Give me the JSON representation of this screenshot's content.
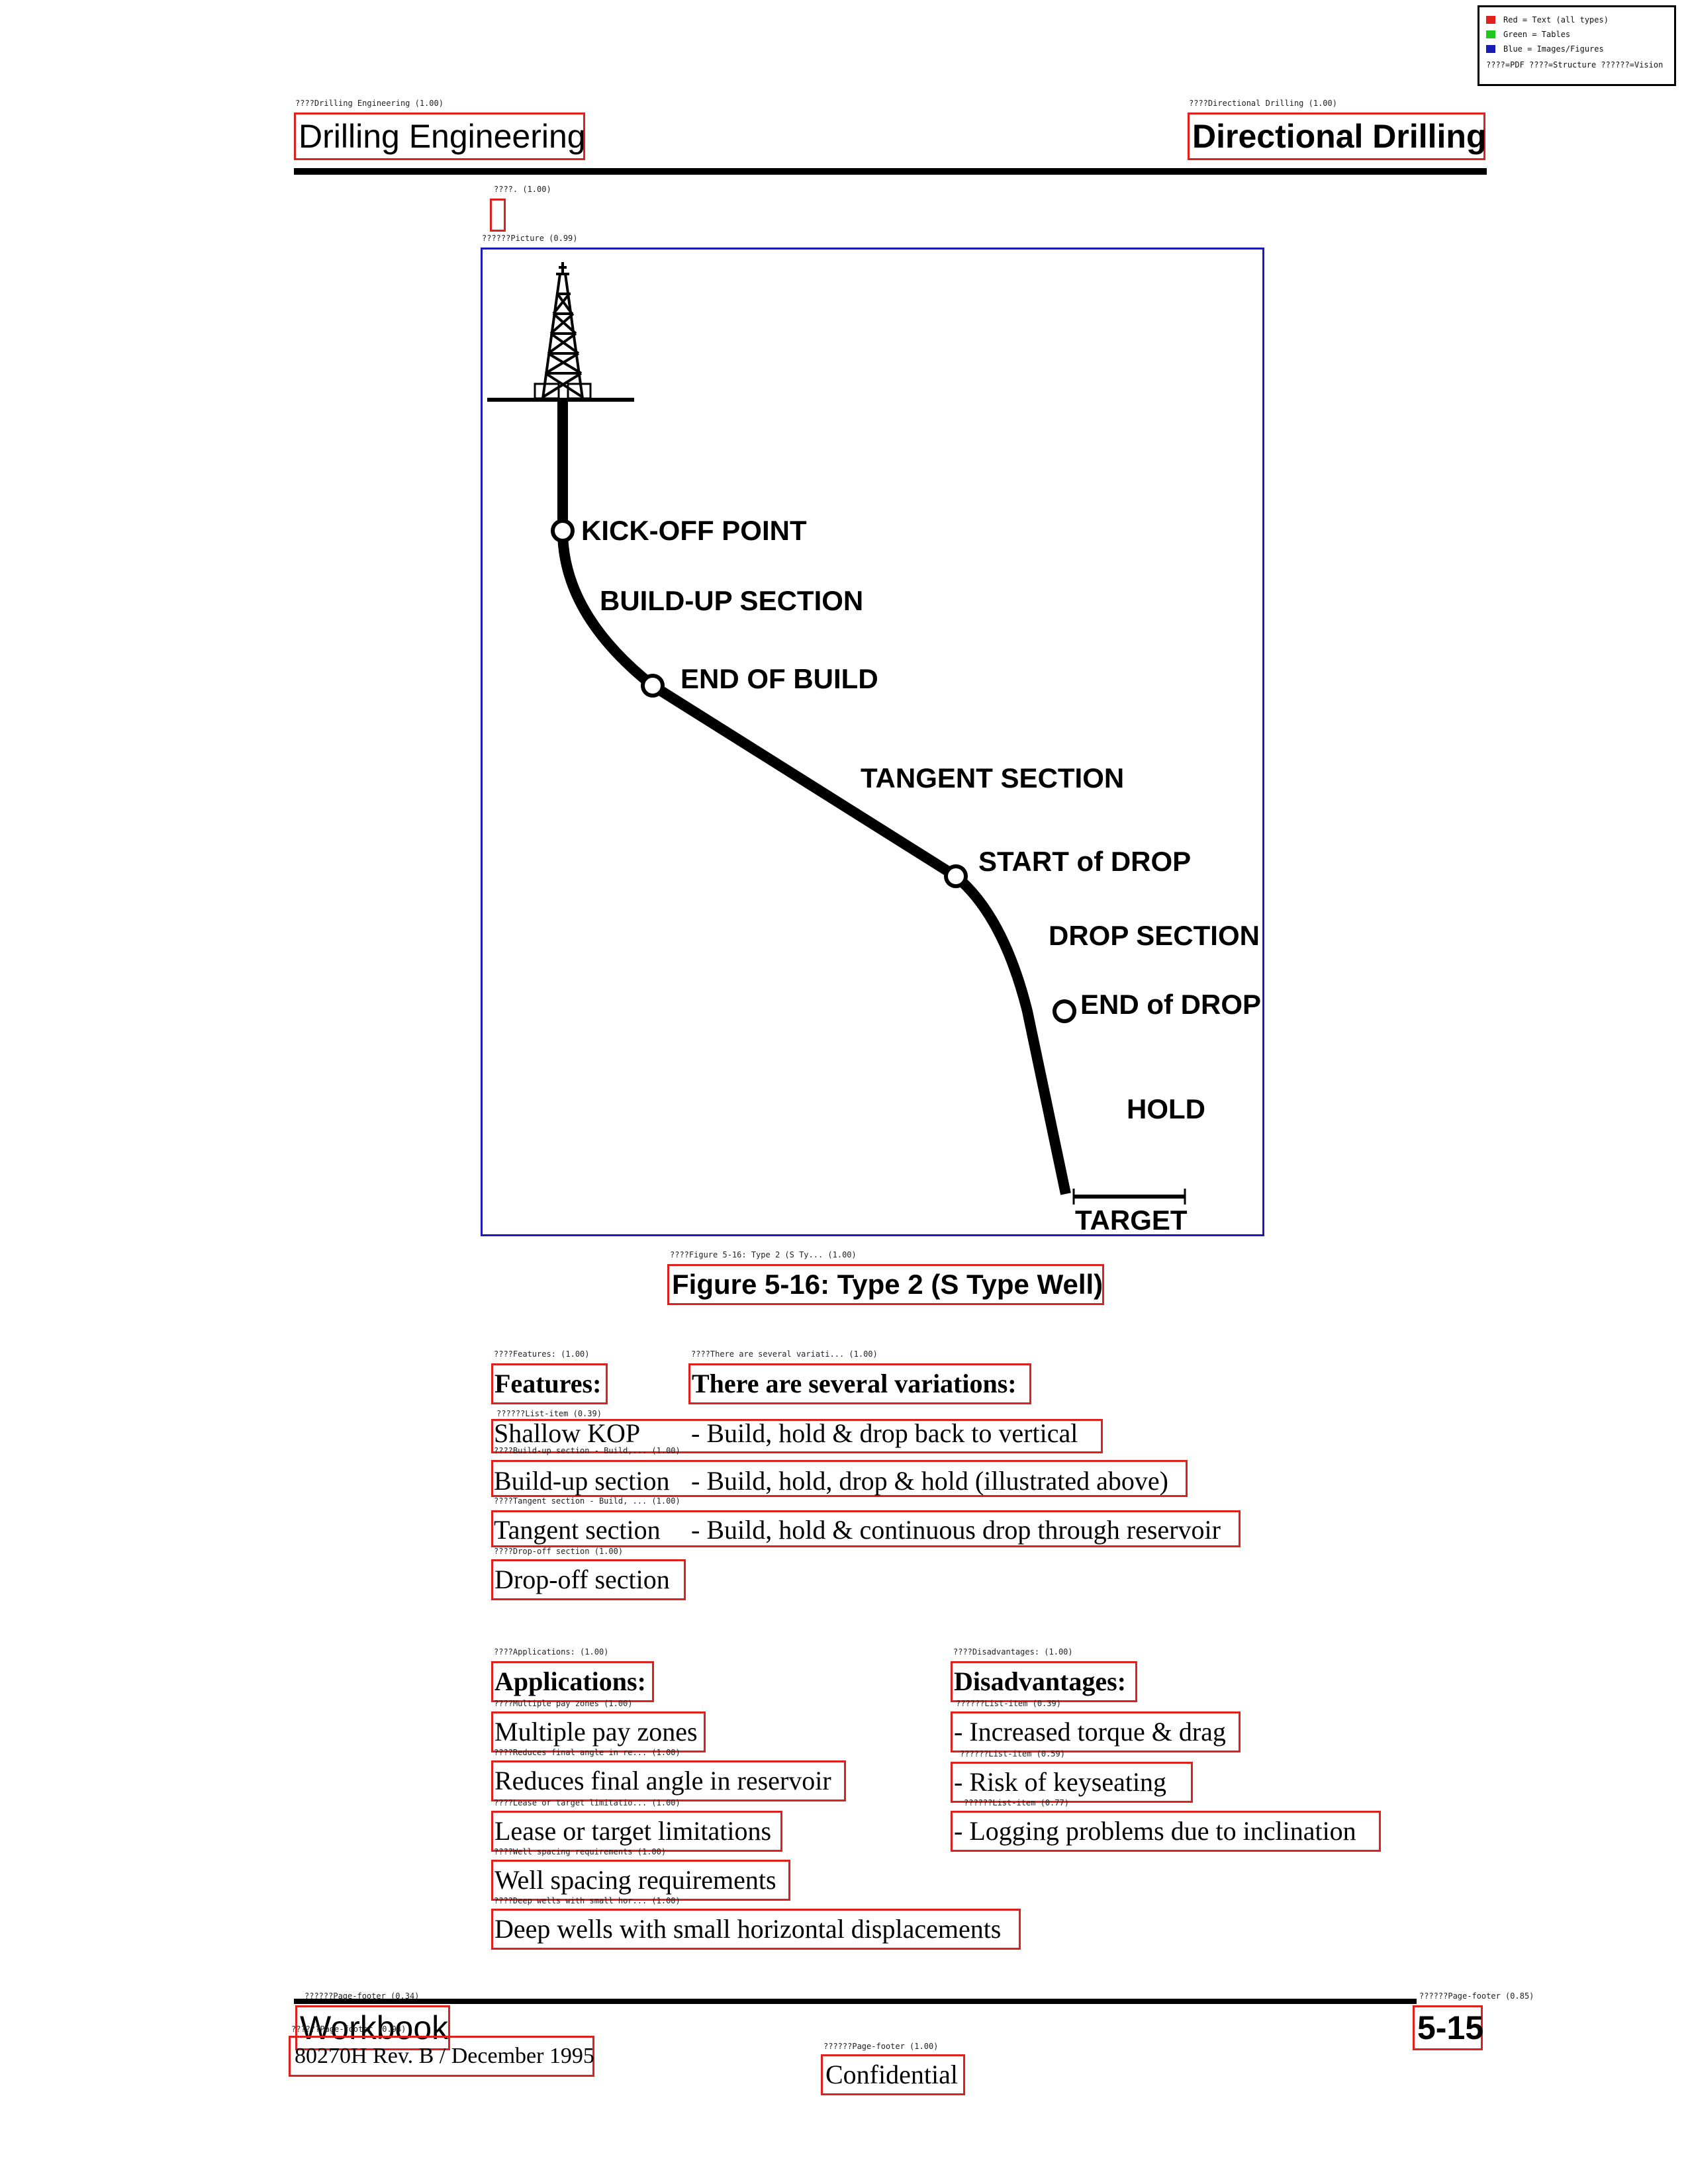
{
  "legend": {
    "items": [
      {
        "color": "#e0201c",
        "label": "Red = Text (all types)"
      },
      {
        "color": "#1ec81e",
        "label": "Green = Tables"
      },
      {
        "color": "#1a1ab4",
        "label": "Blue = Images/Figures"
      }
    ],
    "note": "????=PDF ????=Structure ??????=Vision"
  },
  "header": {
    "left_tag": "????Drilling Engineering (1.00)",
    "left_title": "Drilling Engineering",
    "right_tag": "????Directional Drilling (1.00)",
    "right_title": "Directional Drilling"
  },
  "small_mark_tag": "????. (1.00)",
  "figure": {
    "tag": "??????Picture (0.99)",
    "labels": {
      "kickoff": "KICK-OFF POINT",
      "buildup": "BUILD-UP SECTION",
      "endbuild": "END OF BUILD",
      "tangent": "TANGENT SECTION",
      "startdrop": "START of DROP",
      "dropsection": "DROP SECTION",
      "enddrop": "END of DROP",
      "hold": "HOLD",
      "target": "TARGET"
    },
    "caption_tag": "????Figure 5-16: Type 2 (S Ty... (1.00)",
    "caption": "Figure 5-16: Type 2 (S Type Well)"
  },
  "features": {
    "tag": "????Features: (1.00)",
    "heading": "Features:",
    "variations_tag": "????There are several variati... (1.00)",
    "variations_heading": "There are several variations:",
    "rows": [
      {
        "tag": "??????List-item (0.39)",
        "label": "Shallow KOP",
        "text": "- Build, hold & drop back to vertical"
      },
      {
        "tag": "????Build-up section - Build,... (1.00)",
        "label": "Build-up section",
        "text": "- Build, hold, drop & hold (illustrated above)"
      },
      {
        "tag": "????Tangent section - Build, ... (1.00)",
        "label": "Tangent section",
        "text": "- Build, hold & continuous drop through reservoir"
      },
      {
        "tag": "????Drop-off section (1.00)",
        "label": "Drop-off section",
        "text": ""
      }
    ]
  },
  "applications": {
    "tag": "????Applications: (1.00)",
    "heading": "Applications:",
    "items": [
      {
        "tag": "????Multiple pay zones (1.00)",
        "text": "Multiple pay zones"
      },
      {
        "tag": "????Reduces final angle in re... (1.00)",
        "text": "Reduces final angle in reservoir"
      },
      {
        "tag": "????Lease or target limitatio... (1.00)",
        "text": "Lease or target limitations"
      },
      {
        "tag": "????Well spacing requirements (1.00)",
        "text": "Well spacing requirements"
      },
      {
        "tag": "????Deep wells with small hor... (1.00)",
        "text": "Deep wells with small horizontal displacements"
      }
    ]
  },
  "disadvantages": {
    "tag": "????Disadvantages: (1.00)",
    "heading": "Disadvantages:",
    "items": [
      {
        "tag": "??????List-item (0.39)",
        "text": "- Increased torque & drag"
      },
      {
        "tag": "??????List-item (0.59)",
        "text": "- Risk of keyseating"
      },
      {
        "tag": "??????List-item (0.77)",
        "text": "- Logging problems due to inclination"
      }
    ]
  },
  "footer": {
    "left_tag_1": "??????Page-footer (0.34)",
    "left_text": "Workbook",
    "left_tag_2": "??????Page-footer (0.94)",
    "doc_ref": "80270H Rev. B / December 1995",
    "center_tag": "??????Page-footer (1.00)",
    "center_text": "Confidential",
    "right_tag": "??????Page-footer (0.85)",
    "page_number": "5-15"
  }
}
